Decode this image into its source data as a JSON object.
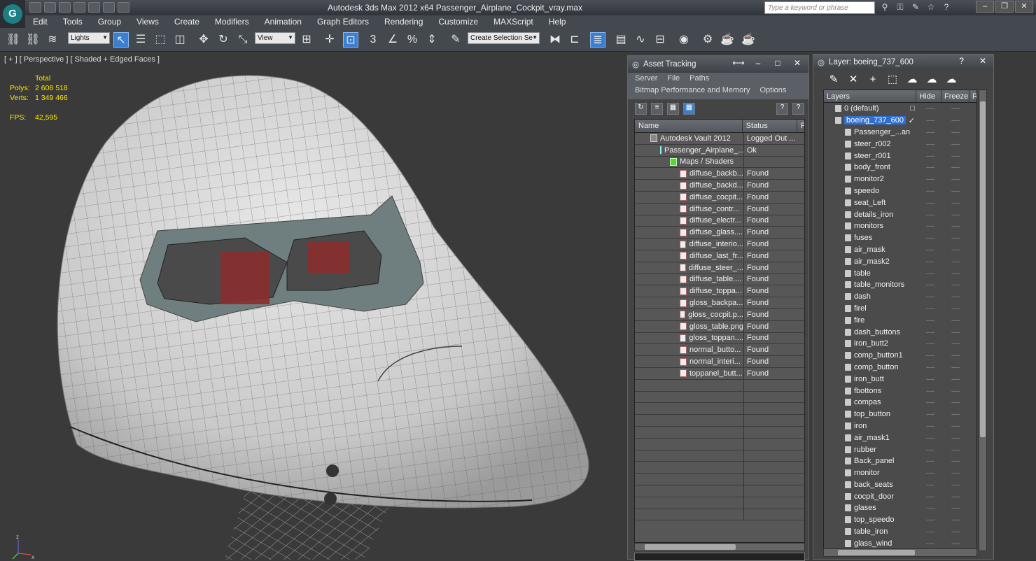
{
  "window": {
    "title": "Autodesk 3ds Max  2012 x64      Passenger_Airplane_Cockpit_vray.max",
    "search_placeholder": "Type a keyword or phrase"
  },
  "menu": [
    "Edit",
    "Tools",
    "Group",
    "Views",
    "Create",
    "Modifiers",
    "Animation",
    "Graph Editors",
    "Rendering",
    "Customize",
    "MAXScript",
    "Help"
  ],
  "toolbar": {
    "lights_dropdown": "Lights",
    "view_dropdown": "View",
    "selection_set": "Create Selection Se"
  },
  "viewport": {
    "label": "[ + ] [ Perspective ] [ Shaded + Edged Faces ]",
    "stats_header": "Total",
    "polys_label": "Polys:",
    "polys_value": "2 608 518",
    "verts_label": "Verts:",
    "verts_value": "1 349 466",
    "fps_label": "FPS:",
    "fps_value": "42,595",
    "axis_x": "x",
    "axis_z": "z"
  },
  "asset_tracking": {
    "title": "Asset Tracking",
    "menu_row1": [
      "Server",
      "File",
      "Paths"
    ],
    "menu_row2": [
      "Bitmap Performance and Memory",
      "Options"
    ],
    "col_name": "Name",
    "col_status": "Status",
    "col_third": "F",
    "rows": [
      {
        "name": "Autodesk Vault 2012",
        "status": "Logged Out ...",
        "kind": "vault",
        "indent": 1
      },
      {
        "name": "Passenger_Airplane_...",
        "status": "Ok",
        "kind": "max",
        "indent": 2
      },
      {
        "name": "Maps / Shaders",
        "status": "",
        "kind": "maps",
        "indent": 3
      },
      {
        "name": "diffuse_backb...",
        "status": "Found",
        "kind": "img",
        "indent": 4
      },
      {
        "name": "diffuse_backd...",
        "status": "Found",
        "kind": "img",
        "indent": 4
      },
      {
        "name": "diffuse_cocpit...",
        "status": "Found",
        "kind": "img",
        "indent": 4
      },
      {
        "name": "diffuse_contr...",
        "status": "Found",
        "kind": "img",
        "indent": 4
      },
      {
        "name": "diffuse_electr...",
        "status": "Found",
        "kind": "img",
        "indent": 4
      },
      {
        "name": "diffuse_glass....",
        "status": "Found",
        "kind": "img",
        "indent": 4
      },
      {
        "name": "diffuse_interio...",
        "status": "Found",
        "kind": "img",
        "indent": 4
      },
      {
        "name": "diffuse_last_fr...",
        "status": "Found",
        "kind": "img",
        "indent": 4
      },
      {
        "name": "diffuse_steer_...",
        "status": "Found",
        "kind": "img",
        "indent": 4
      },
      {
        "name": "diffuse_table....",
        "status": "Found",
        "kind": "img",
        "indent": 4
      },
      {
        "name": "diffuse_toppa...",
        "status": "Found",
        "kind": "img",
        "indent": 4
      },
      {
        "name": "gloss_backpa...",
        "status": "Found",
        "kind": "img",
        "indent": 4
      },
      {
        "name": "gloss_cocpit.p...",
        "status": "Found",
        "kind": "img",
        "indent": 4
      },
      {
        "name": "gloss_table.png",
        "status": "Found",
        "kind": "img",
        "indent": 4
      },
      {
        "name": "gloss_toppan....",
        "status": "Found",
        "kind": "img",
        "indent": 4
      },
      {
        "name": "normal_butto...",
        "status": "Found",
        "kind": "img",
        "indent": 4
      },
      {
        "name": "normal_interi...",
        "status": "Found",
        "kind": "img",
        "indent": 4
      },
      {
        "name": "toppanel_butt...",
        "status": "Found",
        "kind": "img",
        "indent": 4
      }
    ],
    "empty_rows": 12
  },
  "layers": {
    "title": "Layer: boeing_737_600",
    "col_layers": "Layers",
    "col_hide": "Hide",
    "col_freeze": "Freeze",
    "col_r": "R",
    "rows": [
      {
        "name": "0 (default)",
        "level": 0,
        "selected": false,
        "mark": "box"
      },
      {
        "name": "boeing_737_600",
        "level": 0,
        "selected": true,
        "mark": "check"
      },
      {
        "name": "Passenger_...an",
        "level": 1
      },
      {
        "name": "steer_r002",
        "level": 1
      },
      {
        "name": "steer_r001",
        "level": 1
      },
      {
        "name": "body_front",
        "level": 1
      },
      {
        "name": "monitor2",
        "level": 1
      },
      {
        "name": "speedo",
        "level": 1
      },
      {
        "name": "seat_Left",
        "level": 1
      },
      {
        "name": "details_iron",
        "level": 1
      },
      {
        "name": "monitors",
        "level": 1
      },
      {
        "name": "fuses",
        "level": 1
      },
      {
        "name": "air_mask",
        "level": 1
      },
      {
        "name": "air_mask2",
        "level": 1
      },
      {
        "name": "table",
        "level": 1
      },
      {
        "name": "table_monitors",
        "level": 1
      },
      {
        "name": "dash",
        "level": 1
      },
      {
        "name": "firel",
        "level": 1
      },
      {
        "name": "fire",
        "level": 1
      },
      {
        "name": "dash_buttons",
        "level": 1
      },
      {
        "name": "iron_butt2",
        "level": 1
      },
      {
        "name": "comp_button1",
        "level": 1
      },
      {
        "name": "comp_button",
        "level": 1
      },
      {
        "name": "iron_butt",
        "level": 1
      },
      {
        "name": "fbottons",
        "level": 1
      },
      {
        "name": "compas",
        "level": 1
      },
      {
        "name": "top_button",
        "level": 1
      },
      {
        "name": "iron",
        "level": 1
      },
      {
        "name": "air_mask1",
        "level": 1
      },
      {
        "name": "rubber",
        "level": 1
      },
      {
        "name": "Back_panel",
        "level": 1
      },
      {
        "name": "monitor",
        "level": 1
      },
      {
        "name": "back_seats",
        "level": 1
      },
      {
        "name": "cocpit_door",
        "level": 1
      },
      {
        "name": "glases",
        "level": 1
      },
      {
        "name": "top_speedo",
        "level": 1
      },
      {
        "name": "table_iron",
        "level": 1
      },
      {
        "name": "glass_wind",
        "level": 1
      }
    ],
    "dash": "----"
  },
  "colors": {
    "accent": "#3b7fd0",
    "stats": "#ffe600",
    "mesh_fill": "#cfcfcf",
    "wire": "#555555"
  }
}
